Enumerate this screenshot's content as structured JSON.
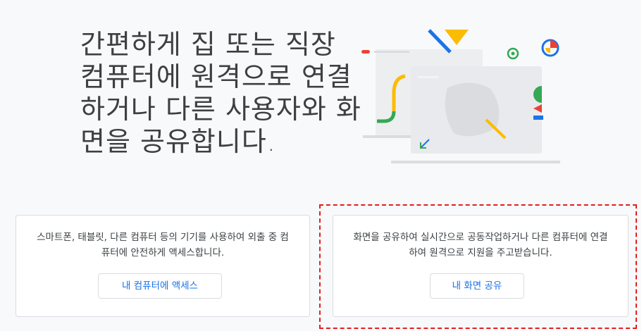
{
  "hero": {
    "title": "간편하게 집 또는 직장 컴퓨터에 원격으로 연결하거나 다른 사용자와 화면을 공유합니다."
  },
  "cards": [
    {
      "description": "스마트폰, 태블릿, 다른 컴퓨터 등의 기기를 사용하여 외출 중 컴퓨터에 안전하게 액세스합니다.",
      "button_label": "내 컴퓨터에 액세스"
    },
    {
      "description": "화면을 공유하여 실시간으로 공동작업하거나 다른 컴퓨터에 연결하여 원격으로 지원을 주고받습니다.",
      "button_label": "내 화면 공유"
    }
  ],
  "colors": {
    "accent_blue": "#1a73e8",
    "text": "#3c4043",
    "highlight": "#e02020"
  }
}
